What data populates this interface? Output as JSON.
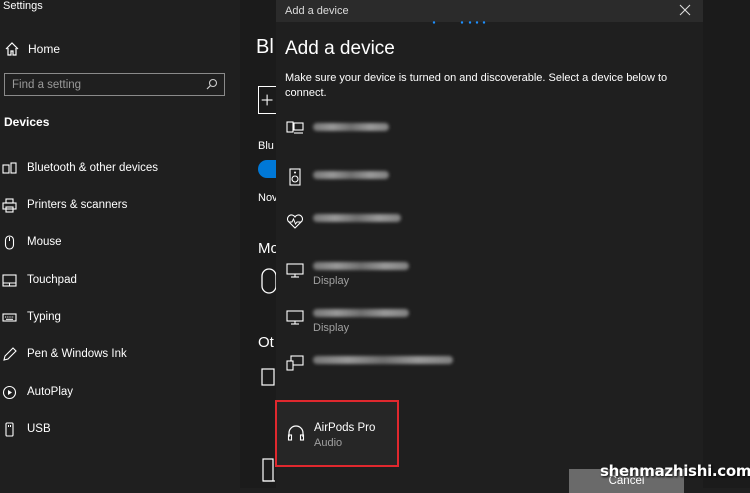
{
  "app_title": "Settings",
  "sidebar": {
    "home_label": "Home",
    "search_placeholder": "Find a setting",
    "section_label": "Devices",
    "items": [
      {
        "label": "Bluetooth & other devices",
        "icon": "bluetooth-devices-icon"
      },
      {
        "label": "Printers & scanners",
        "icon": "printer-icon"
      },
      {
        "label": "Mouse",
        "icon": "mouse-icon"
      },
      {
        "label": "Touchpad",
        "icon": "touchpad-icon"
      },
      {
        "label": "Typing",
        "icon": "keyboard-icon"
      },
      {
        "label": "Pen & Windows Ink",
        "icon": "pen-icon"
      },
      {
        "label": "AutoPlay",
        "icon": "autoplay-icon"
      },
      {
        "label": "USB",
        "icon": "usb-icon"
      }
    ]
  },
  "background_page": {
    "title_fragment": "Bl",
    "toggle_label_fragment": "Blu",
    "now_fragment": "Nov",
    "mouse_section_fragment": "Mo",
    "other_section_fragment": "Ot"
  },
  "dialog": {
    "window_title": "Add a device",
    "heading": "Add a device",
    "description": "Make sure your device is turned on and discoverable. Select a device below to connect.",
    "devices": [
      {
        "name": "",
        "subtitle": "",
        "icon": "computer-icon"
      },
      {
        "name": "",
        "subtitle": "",
        "icon": "speaker-icon"
      },
      {
        "name": "",
        "subtitle": "",
        "icon": "heart-health-icon"
      },
      {
        "name": "",
        "subtitle": "Display",
        "icon": "monitor-icon"
      },
      {
        "name": "",
        "subtitle": "Display",
        "icon": "monitor-icon"
      },
      {
        "name": "",
        "subtitle": "",
        "icon": "devices-icon"
      },
      {
        "name": "AirPods Pro",
        "subtitle": "Audio",
        "icon": "headphones-icon"
      }
    ],
    "cancel_label": "Cancel"
  },
  "watermark": "shenmazhishi.com",
  "colors": {
    "background": "#1f1f1f",
    "highlight_border": "#e0282e",
    "accent": "#0078d7",
    "button": "#6a6a6a"
  }
}
